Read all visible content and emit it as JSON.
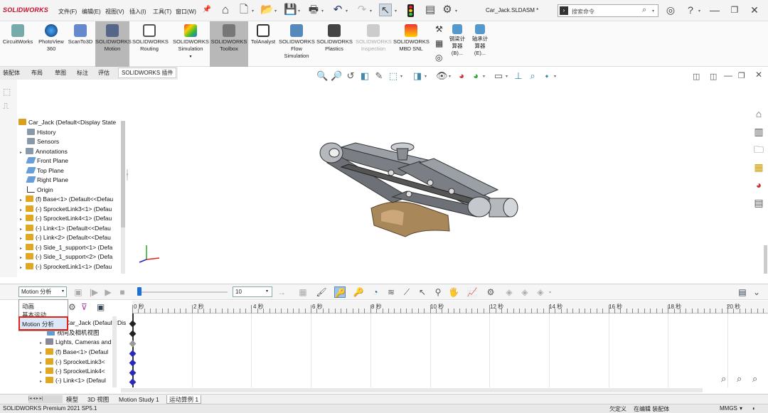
{
  "app": {
    "brand": "SOLIDWORKS",
    "document_title": "Car_Jack.SLDASM *"
  },
  "menus": [
    "文件(F)",
    "编辑(E)",
    "视图(V)",
    "插入(I)",
    "工具(T)",
    "窗口(W)"
  ],
  "search": {
    "placeholder": "搜索命令"
  },
  "commands": [
    {
      "label": "CircuitWorks",
      "label2": ""
    },
    {
      "label": "PhotoView",
      "label2": "360"
    },
    {
      "label": "ScanTo3D",
      "label2": ""
    },
    {
      "label": "SOLIDWORKS",
      "label2": "Motion",
      "active": true
    },
    {
      "label": "SOLIDWORKS",
      "label2": "Routing"
    },
    {
      "label": "SOLIDWORKS",
      "label2": "Simulation"
    },
    {
      "label": "SOLIDWORKS",
      "label2": "Toolbox",
      "active": true
    },
    {
      "label": "TolAnalyst",
      "label2": ""
    },
    {
      "label": "SOLIDWORKS",
      "label2": "Flow",
      "label3": "Simulation"
    },
    {
      "label": "SOLIDWORKS",
      "label2": "Plastics"
    },
    {
      "label": "SOLIDWORKS",
      "label2": "Inspection",
      "dim": true
    },
    {
      "label": "SOLIDWORKS",
      "label2": "MBD SNL"
    },
    {
      "label": "钢梁计",
      "label2": "算器",
      "label3": "(B)..."
    },
    {
      "label": "轴承计",
      "label2": "算器",
      "label3": "(E)..."
    }
  ],
  "tabs": [
    "装配体",
    "布局",
    "草图",
    "标注",
    "评估",
    "SOLIDWORKS 插件"
  ],
  "feature_tree": {
    "root": "Car_Jack  (Default<Display State",
    "items": [
      "History",
      "Sensors",
      "Annotations",
      "Front Plane",
      "Top Plane",
      "Right Plane",
      "Origin",
      "(f) Base<1> (Default<<Defau",
      "(-) SprocketLink3<1> (Defau",
      "(-) SprocketLink4<1> (Defau",
      "(-) Link<1> (Default<<Defau",
      "(-) Link<2> (Default<<Defau",
      "(-) Side_1_support<1> (Defa",
      "(-) Side_1_support<2> (Defa",
      "(-) SprocketLink1<1> (Defau"
    ]
  },
  "motion": {
    "study_type": "Motion 分析",
    "study_options": [
      "动画",
      "基本运动",
      "Motion 分析"
    ],
    "time_field": "10",
    "timeline_labels": [
      "0 秒",
      "2 秒",
      "4 秒",
      "6 秒",
      "8 秒",
      "10 秒",
      "12 秒",
      "14 秒",
      "16 秒",
      "18 秒",
      "20 秒"
    ],
    "tree": [
      "Car_Jack  (Default<Dis",
      "视向及相机视图",
      "Lights, Cameras and",
      "(f) Base<1> (Defaul",
      "(-) SprocketLink3<",
      "(-) SprocketLink4<",
      "(-) Link<1> (Defaul"
    ]
  },
  "bottom_tabs": [
    "模型",
    "3D 视图",
    "Motion Study 1",
    "运动算例 1"
  ],
  "status": {
    "left": "SOLIDWORKS Premium 2021 SP5.1",
    "custom": "欠定义",
    "editing": "在编辑 装配体",
    "units": "MMGS"
  }
}
